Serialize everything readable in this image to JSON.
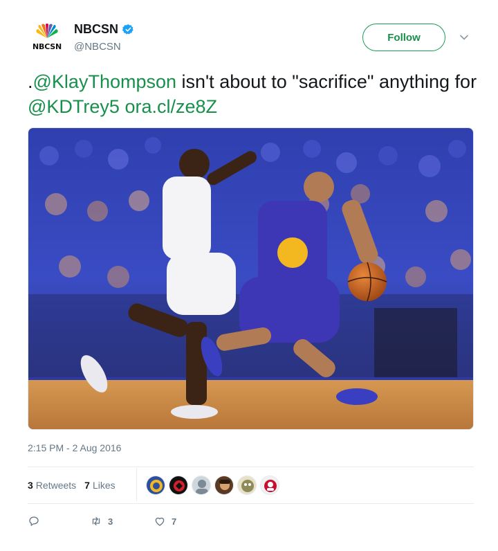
{
  "account": {
    "display_name": "NBCSN",
    "handle": "@NBCSN",
    "logo_text": "NBCSN",
    "verified": true
  },
  "follow_button": {
    "label": "Follow"
  },
  "tweet": {
    "prefix": ".",
    "mention_1": "@KlayThompson",
    "text_1": " isn't about to \"sacrifice\" anything for ",
    "mention_2": "@KDTrey5",
    "space": " ",
    "link": "ora.cl/ze8Z"
  },
  "timestamp": "2:15 PM - 2 Aug 2016",
  "stats": {
    "retweets_count": "3",
    "retweets_label": "Retweets",
    "likes_count": "7",
    "likes_label": "Likes"
  },
  "actions": {
    "retweet_count": "3",
    "like_count": "7"
  },
  "colors": {
    "link": "#17904c",
    "muted": "#657786",
    "verified": "#1da1f2"
  },
  "icons": [
    "nbc-peacock-logo",
    "verified-badge-icon",
    "chevron-down-icon",
    "reply-icon",
    "retweet-icon",
    "heart-icon"
  ]
}
